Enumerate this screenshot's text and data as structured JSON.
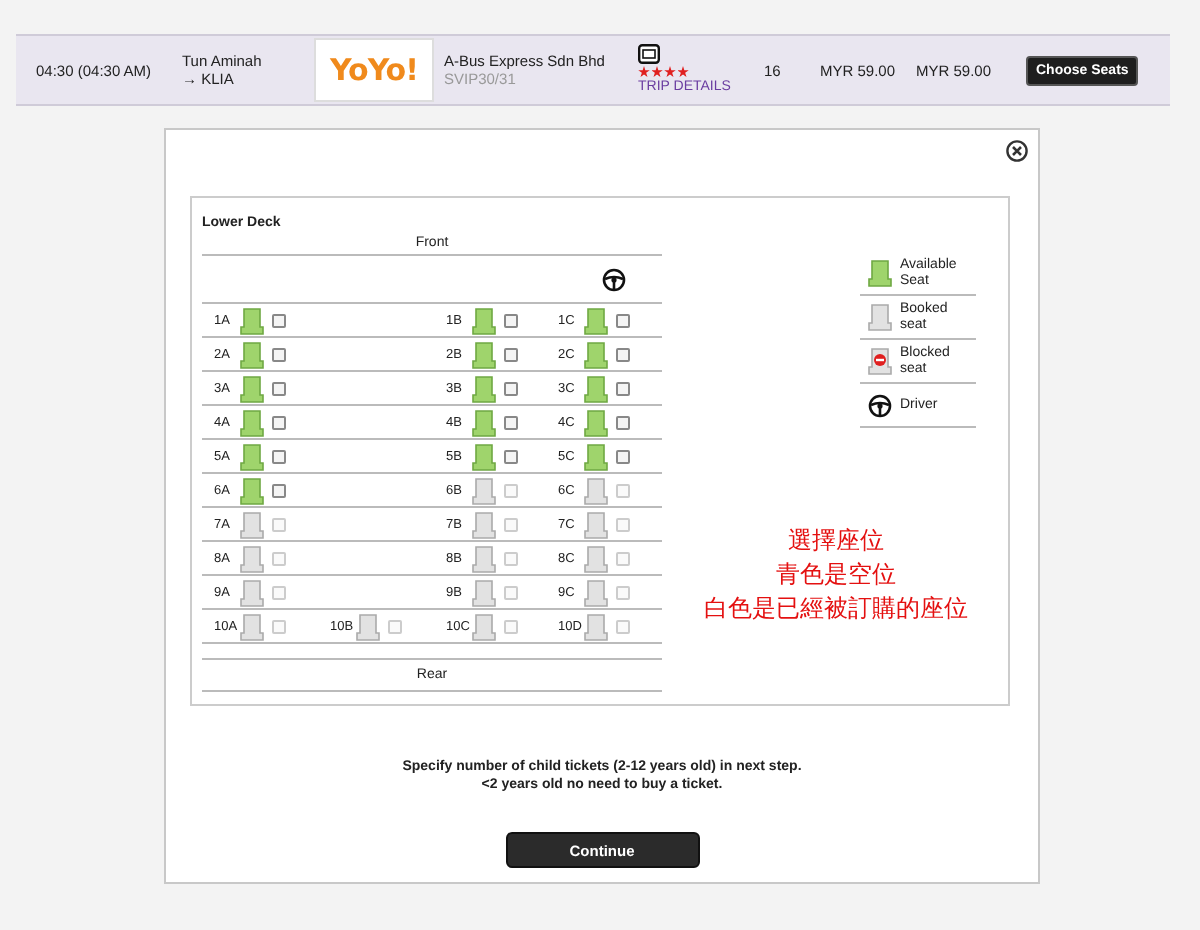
{
  "trip_row": {
    "departure": "04:30 (04:30 AM)",
    "route_from": "Tun Aminah",
    "route_to": "→ KLIA",
    "logo_text": "YoYo!",
    "operator": "A-Bus Express Sdn Bhd",
    "coach": "SVIP30/31",
    "stars": 4,
    "trip_details": "TRIP DETAILS",
    "seats_left": "16",
    "price_adult": "MYR 59.00",
    "price_total": "MYR 59.00",
    "button": "Choose Seats"
  },
  "dialog": {
    "deck_title": "Lower Deck",
    "front_label": "Front",
    "rear_label": "Rear",
    "seat_rows": [
      {
        "kind": "standard",
        "seats": [
          {
            "label": "1A",
            "kind": "available",
            "checked": false
          },
          {
            "label": "1B",
            "kind": "available",
            "checked": false
          },
          {
            "label": "1C",
            "kind": "available",
            "checked": false
          }
        ]
      },
      {
        "kind": "standard",
        "seats": [
          {
            "label": "2A",
            "kind": "available",
            "checked": false
          },
          {
            "label": "2B",
            "kind": "available",
            "checked": false
          },
          {
            "label": "2C",
            "kind": "available",
            "checked": false
          }
        ]
      },
      {
        "kind": "standard",
        "seats": [
          {
            "label": "3A",
            "kind": "available",
            "checked": false
          },
          {
            "label": "3B",
            "kind": "available",
            "checked": false
          },
          {
            "label": "3C",
            "kind": "available",
            "checked": false
          }
        ]
      },
      {
        "kind": "standard",
        "seats": [
          {
            "label": "4A",
            "kind": "available",
            "checked": false
          },
          {
            "label": "4B",
            "kind": "available",
            "checked": false
          },
          {
            "label": "4C",
            "kind": "available",
            "checked": false
          }
        ]
      },
      {
        "kind": "standard",
        "seats": [
          {
            "label": "5A",
            "kind": "available",
            "checked": false
          },
          {
            "label": "5B",
            "kind": "available",
            "checked": false
          },
          {
            "label": "5C",
            "kind": "available",
            "checked": false
          }
        ]
      },
      {
        "kind": "standard",
        "seats": [
          {
            "label": "6A",
            "kind": "available",
            "checked": false
          },
          {
            "label": "6B",
            "kind": "booked",
            "checked": false
          },
          {
            "label": "6C",
            "kind": "booked",
            "checked": false
          }
        ]
      },
      {
        "kind": "standard",
        "seats": [
          {
            "label": "7A",
            "kind": "booked",
            "checked": false
          },
          {
            "label": "7B",
            "kind": "booked",
            "checked": false
          },
          {
            "label": "7C",
            "kind": "booked",
            "checked": false
          }
        ]
      },
      {
        "kind": "standard",
        "seats": [
          {
            "label": "8A",
            "kind": "booked",
            "checked": false
          },
          {
            "label": "8B",
            "kind": "booked",
            "checked": false
          },
          {
            "label": "8C",
            "kind": "booked",
            "checked": false
          }
        ]
      },
      {
        "kind": "standard",
        "seats": [
          {
            "label": "9A",
            "kind": "booked",
            "checked": false
          },
          {
            "label": "9B",
            "kind": "booked",
            "checked": false
          },
          {
            "label": "9C",
            "kind": "booked",
            "checked": false
          }
        ]
      },
      {
        "kind": "back",
        "seats": [
          {
            "label": "10A",
            "kind": "booked",
            "checked": false
          },
          {
            "label": "10B",
            "kind": "booked",
            "checked": false
          },
          {
            "label": "10C",
            "kind": "booked",
            "checked": false
          },
          {
            "label": "10D",
            "kind": "booked",
            "checked": false
          }
        ]
      }
    ],
    "legend": [
      {
        "kind": "available",
        "label": "Available Seat"
      },
      {
        "kind": "booked",
        "label": "Booked seat"
      },
      {
        "kind": "blocked",
        "label": "Blocked seat"
      },
      {
        "kind": "driver",
        "label": "Driver"
      }
    ],
    "annotation": [
      "選擇座位",
      "青色是空位",
      "白色是已經被訂購的座位"
    ],
    "notes": [
      "Specify number of child tickets (2-12 years old) in next step.",
      "<2 years old no need to buy a ticket."
    ],
    "continue_button": "Continue"
  }
}
